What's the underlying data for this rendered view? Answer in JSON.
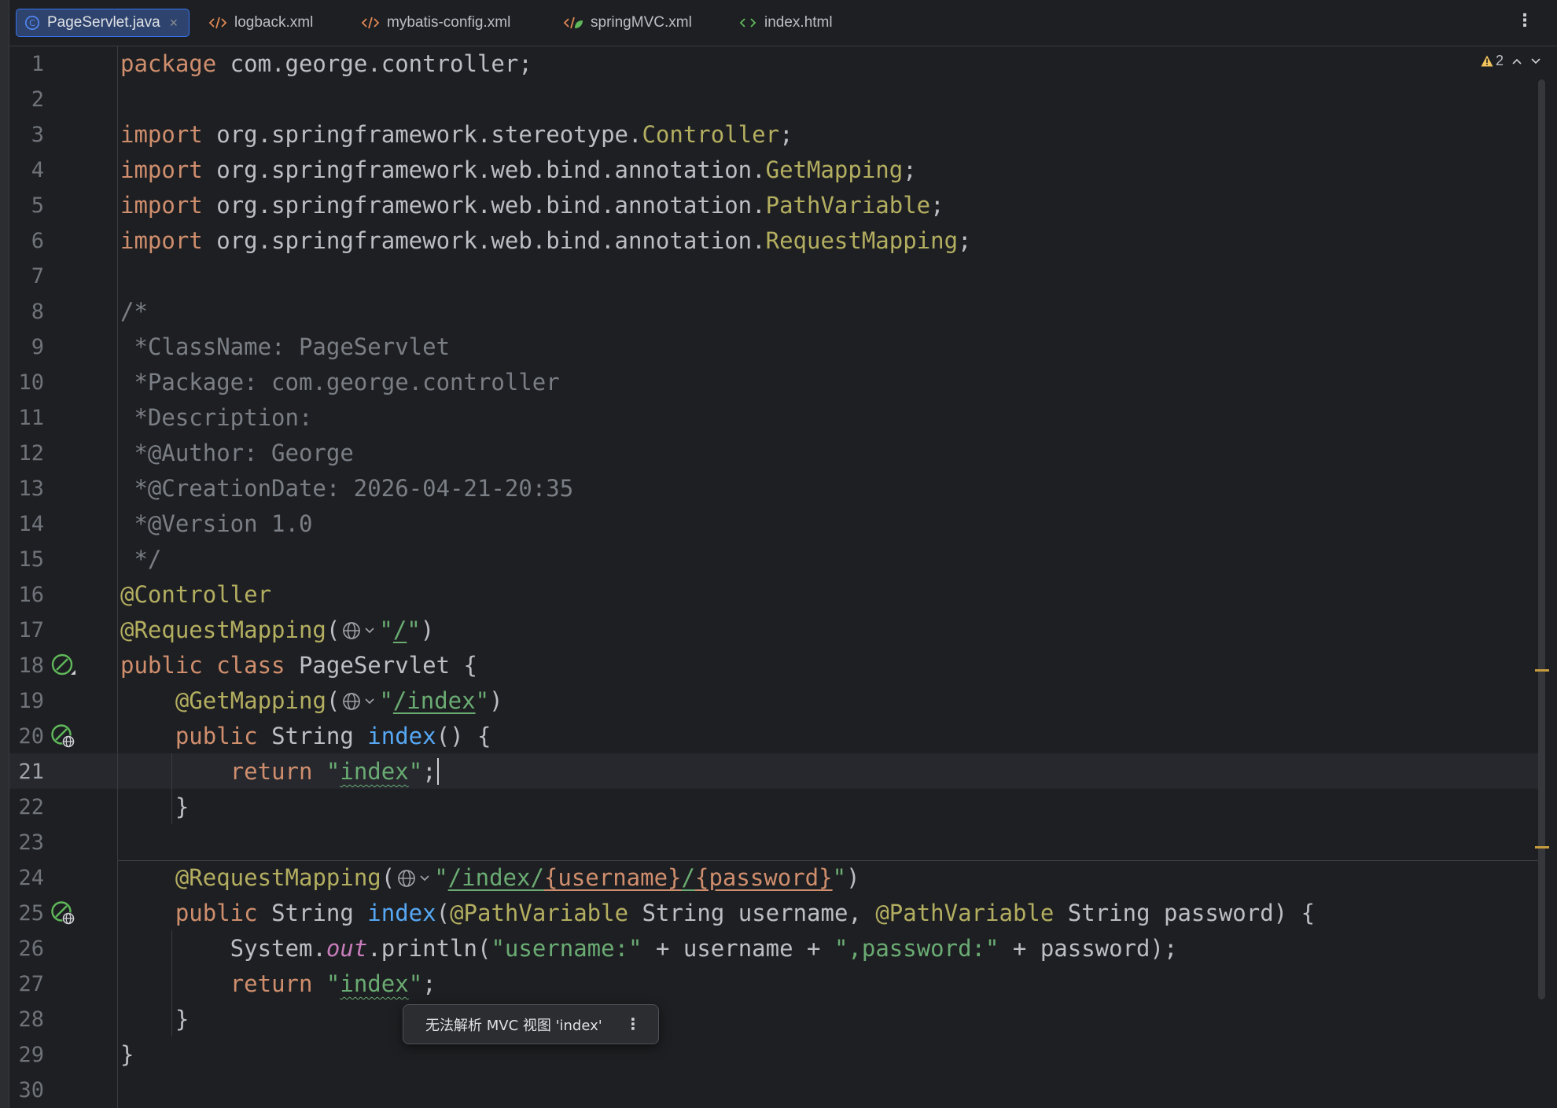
{
  "tabs": [
    {
      "label": "PageServlet.java",
      "active": true
    },
    {
      "label": "logback.xml",
      "active": false
    },
    {
      "label": "mybatis-config.xml",
      "active": false
    },
    {
      "label": "springMVC.xml",
      "active": false
    },
    {
      "label": "index.html",
      "active": false
    }
  ],
  "menu": {
    "more_label": "⋮"
  },
  "inspection": {
    "warnings": "2"
  },
  "editor": {
    "current_line": "21",
    "lines": [
      {
        "n": "1",
        "t": "package com.george.controller;"
      },
      {
        "n": "2",
        "t": ""
      },
      {
        "n": "3",
        "t": "import org.springframework.stereotype.Controller;"
      },
      {
        "n": "4",
        "t": "import org.springframework.web.bind.annotation.GetMapping;"
      },
      {
        "n": "5",
        "t": "import org.springframework.web.bind.annotation.PathVariable;"
      },
      {
        "n": "6",
        "t": "import org.springframework.web.bind.annotation.RequestMapping;"
      },
      {
        "n": "7",
        "t": ""
      },
      {
        "n": "8",
        "t": "/*"
      },
      {
        "n": "9",
        "t": " *ClassName: PageServlet"
      },
      {
        "n": "10",
        "t": " *Package: com.george.controller"
      },
      {
        "n": "11",
        "t": " *Description:"
      },
      {
        "n": "12",
        "t": " *@Author: George"
      },
      {
        "n": "13",
        "t": " *@CreationDate: 2026-04-21-20:35"
      },
      {
        "n": "14",
        "t": " *@Version 1.0"
      },
      {
        "n": "15",
        "t": " */"
      },
      {
        "n": "16",
        "t": "@Controller"
      },
      {
        "n": "17",
        "t": "@RequestMapping(\"/\")"
      },
      {
        "n": "18",
        "t": "public class PageServlet {"
      },
      {
        "n": "19",
        "t": "    @GetMapping(\"/index\")"
      },
      {
        "n": "20",
        "t": "    public String index() {"
      },
      {
        "n": "21",
        "t": "        return \"index\";"
      },
      {
        "n": "22",
        "t": "    }"
      },
      {
        "n": "23",
        "t": ""
      },
      {
        "n": "24",
        "t": "    @RequestMapping(\"/index/{username}/{password}\")"
      },
      {
        "n": "25",
        "t": "    public String index(@PathVariable String username, @PathVariable String password) {"
      },
      {
        "n": "26",
        "t": "        System.out.println(\"username:\" + username + \",password:\" + password);"
      },
      {
        "n": "27",
        "t": "        return \"index\";"
      },
      {
        "n": "28",
        "t": "    }"
      },
      {
        "n": "29",
        "t": "}"
      },
      {
        "n": "30",
        "t": ""
      }
    ]
  },
  "tooltip": {
    "message": "无法解析 MVC 视图 'index'",
    "more_label": "⋮"
  },
  "colors": {
    "keyword": "#cf8e6d",
    "annotation": "#b3ae60",
    "string": "#6aab73",
    "comment": "#7a7e85",
    "method": "#56a8f5",
    "static_field": "#c77dbb",
    "plain": "#bcbec4",
    "background": "#1e1f22",
    "active_tab": "#2e436e"
  },
  "icons": {
    "java_class": "java-class-icon",
    "xml": "xml-file-icon",
    "spring_xml": "spring-xml-icon",
    "html": "html-file-icon",
    "web_endpoint": "globe-endpoint-icon",
    "spring_bean": "spring-bean-icon",
    "warning": "warning-icon"
  }
}
